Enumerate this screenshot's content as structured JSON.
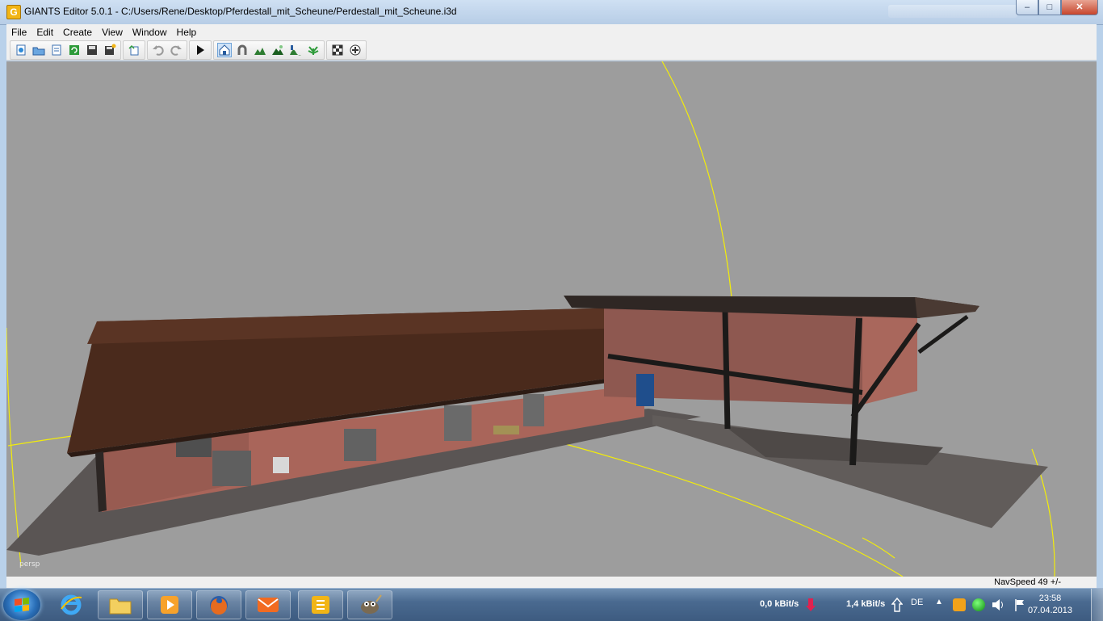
{
  "window": {
    "title": "GIANTS Editor 5.0.1 - C:/Users/Rene/Desktop/Pferdestall_mit_Scheune/Perdestall_mit_Scheune.i3d",
    "app_icon_letter": "G",
    "controls": {
      "minimize": "–",
      "maximize": "□",
      "close": "✕"
    }
  },
  "menu": [
    {
      "label": "File"
    },
    {
      "label": "Edit"
    },
    {
      "label": "Create"
    },
    {
      "label": "View"
    },
    {
      "label": "Window"
    },
    {
      "label": "Help"
    }
  ],
  "toolbar": {
    "groups": [
      [
        "new-icon",
        "open-icon",
        "import-icon",
        "reload-icon",
        "save-icon",
        "save-as-icon"
      ],
      [
        "export-icon"
      ],
      [
        "undo-icon",
        "redo-icon"
      ],
      [
        "play-icon"
      ],
      [
        "select-mode-icon",
        "magnet-icon",
        "terrain-sculpt-icon",
        "terrain-paint-icon",
        "terrain-smooth-icon",
        "foliage-paint-icon"
      ],
      [
        "texture-paint-icon",
        "texture-erase-icon"
      ]
    ],
    "active": "select-mode-icon"
  },
  "viewport": {
    "camera_label": "persp",
    "background_color": "#9d9d9d"
  },
  "status": {
    "navspeed": "NavSpeed 49 +/-"
  },
  "taskbar": {
    "apps": [
      {
        "name": "internet-explorer-icon",
        "pinned": false
      },
      {
        "name": "file-explorer-icon",
        "pinned": true
      },
      {
        "name": "media-player-icon",
        "pinned": true
      },
      {
        "name": "firefox-icon",
        "pinned": true
      },
      {
        "name": "mail-icon",
        "pinned": true
      },
      {
        "name": "giants-editor-icon",
        "pinned": true
      },
      {
        "name": "gimp-icon",
        "pinned": true
      }
    ],
    "network_down": "0,0  kBit/s",
    "network_up": "1,4  kBit/s",
    "language": "DE",
    "time": "23:58",
    "date": "07.04.2013"
  },
  "colors": {
    "grid_line": "#f2ec0a",
    "roof": "#4a2a1c",
    "brick": "#a9655a",
    "ground": "#5a5554"
  }
}
